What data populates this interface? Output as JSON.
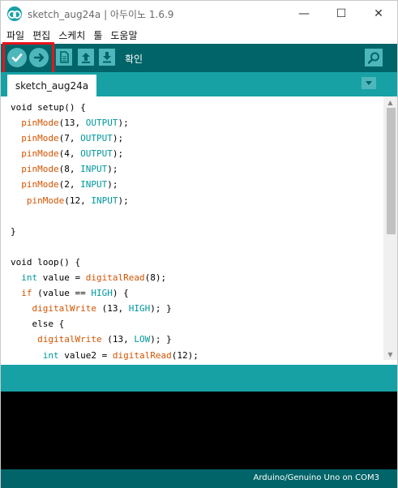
{
  "window": {
    "title": "sketch_aug24a | 아두이노 1.6.9",
    "controls": {
      "minimize": "—",
      "maximize": "☐",
      "close": "✕"
    }
  },
  "menu": [
    "파일",
    "편집",
    "스케치",
    "툴",
    "도움말"
  ],
  "toolbar": {
    "verify_icon": "check-icon",
    "upload_icon": "arrow-right-icon",
    "new_icon": "file-icon",
    "open_icon": "arrow-up-icon",
    "save_icon": "arrow-down-icon",
    "status_label": "확인",
    "serial_icon": "magnifier-icon",
    "highlight_color": "#e8141b"
  },
  "tabs": [
    {
      "label": "sketch_aug24a",
      "active": true
    }
  ],
  "code": [
    [
      {
        "t": "void setup() {",
        "c": ""
      }
    ],
    [
      {
        "t": "  ",
        "c": ""
      },
      {
        "t": "pinMode",
        "c": "fn"
      },
      {
        "t": "(13, ",
        "c": ""
      },
      {
        "t": "OUTPUT",
        "c": "const"
      },
      {
        "t": ");",
        "c": ""
      }
    ],
    [
      {
        "t": "  ",
        "c": ""
      },
      {
        "t": "pinMode",
        "c": "fn"
      },
      {
        "t": "(7, ",
        "c": ""
      },
      {
        "t": "OUTPUT",
        "c": "const"
      },
      {
        "t": ");",
        "c": ""
      }
    ],
    [
      {
        "t": "  ",
        "c": ""
      },
      {
        "t": "pinMode",
        "c": "fn"
      },
      {
        "t": "(4, ",
        "c": ""
      },
      {
        "t": "OUTPUT",
        "c": "const"
      },
      {
        "t": ");",
        "c": ""
      }
    ],
    [
      {
        "t": "  ",
        "c": ""
      },
      {
        "t": "pinMode",
        "c": "fn"
      },
      {
        "t": "(8, ",
        "c": ""
      },
      {
        "t": "INPUT",
        "c": "const"
      },
      {
        "t": ");",
        "c": ""
      }
    ],
    [
      {
        "t": "  ",
        "c": ""
      },
      {
        "t": "pinMode",
        "c": "fn"
      },
      {
        "t": "(2, ",
        "c": ""
      },
      {
        "t": "INPUT",
        "c": "const"
      },
      {
        "t": ");",
        "c": ""
      }
    ],
    [
      {
        "t": "   ",
        "c": ""
      },
      {
        "t": "pinMode",
        "c": "fn"
      },
      {
        "t": "(12, ",
        "c": ""
      },
      {
        "t": "INPUT",
        "c": "const"
      },
      {
        "t": ");",
        "c": ""
      }
    ],
    [
      {
        "t": "",
        "c": ""
      }
    ],
    [
      {
        "t": "}",
        "c": ""
      }
    ],
    [
      {
        "t": "",
        "c": ""
      }
    ],
    [
      {
        "t": "void loop() {",
        "c": ""
      }
    ],
    [
      {
        "t": "  ",
        "c": ""
      },
      {
        "t": "int",
        "c": "type"
      },
      {
        "t": " value = ",
        "c": ""
      },
      {
        "t": "digitalRead",
        "c": "fn"
      },
      {
        "t": "(8);",
        "c": ""
      }
    ],
    [
      {
        "t": "  ",
        "c": ""
      },
      {
        "t": "if",
        "c": "fn"
      },
      {
        "t": " (value == ",
        "c": ""
      },
      {
        "t": "HIGH",
        "c": "const"
      },
      {
        "t": ") {",
        "c": ""
      }
    ],
    [
      {
        "t": "    ",
        "c": ""
      },
      {
        "t": "digitalWrite",
        "c": "fn"
      },
      {
        "t": " (13, ",
        "c": ""
      },
      {
        "t": "HIGH",
        "c": "const"
      },
      {
        "t": "); }",
        "c": ""
      }
    ],
    [
      {
        "t": "    else {",
        "c": ""
      }
    ],
    [
      {
        "t": "     ",
        "c": ""
      },
      {
        "t": "digitalWrite",
        "c": "fn"
      },
      {
        "t": " (13, ",
        "c": ""
      },
      {
        "t": "LOW",
        "c": "const"
      },
      {
        "t": "); }",
        "c": ""
      }
    ],
    [
      {
        "t": "      ",
        "c": ""
      },
      {
        "t": "int",
        "c": "type"
      },
      {
        "t": " value2 = ",
        "c": ""
      },
      {
        "t": "digitalRead",
        "c": "fn"
      },
      {
        "t": "(12);",
        "c": ""
      }
    ]
  ],
  "status": {
    "board": "Arduino/Genuino Uno on COM3"
  },
  "colors": {
    "teal_dark": "#006468",
    "teal": "#17a1a5",
    "button": "#4db7bb",
    "keyword_fn": "#d35400",
    "keyword_const": "#00979c"
  }
}
